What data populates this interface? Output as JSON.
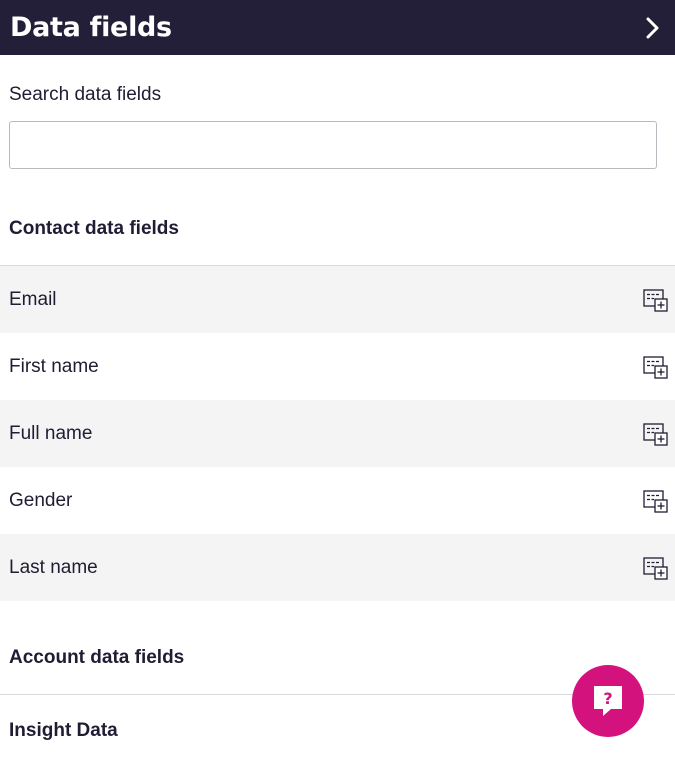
{
  "header": {
    "title": "Data fields",
    "collapse_icon": "chevron-right-icon"
  },
  "search": {
    "label": "Search data fields",
    "value": "",
    "placeholder": ""
  },
  "sections": {
    "contact": {
      "title": "Contact data fields",
      "fields": [
        {
          "label": "Email",
          "icon": "add-field-icon"
        },
        {
          "label": "First name",
          "icon": "add-field-icon"
        },
        {
          "label": "Full name",
          "icon": "add-field-icon"
        },
        {
          "label": "Gender",
          "icon": "add-field-icon"
        },
        {
          "label": "Last name",
          "icon": "add-field-icon"
        }
      ]
    },
    "account": {
      "title": "Account data fields"
    },
    "insight": {
      "title": "Insight Data"
    }
  },
  "help": {
    "icon": "help-chat-icon",
    "glyph": "?"
  },
  "colors": {
    "header_bg": "#231f38",
    "accent": "#d4127e",
    "row_alt": "#f4f4f4"
  }
}
